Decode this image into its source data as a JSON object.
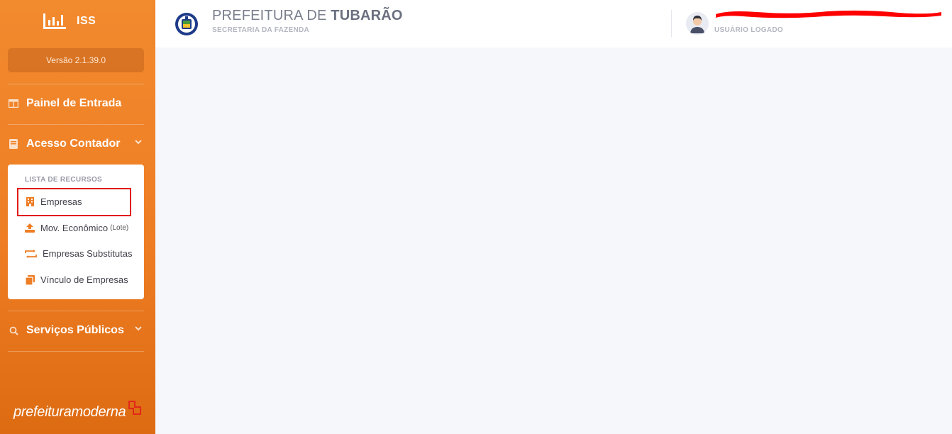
{
  "sidebar": {
    "brand": "ISS",
    "version": "Versão 2.1.39.0",
    "menu": [
      {
        "label": "Painel de Entrada",
        "icon": "dashboard-icon"
      },
      {
        "label": "Acesso Contador",
        "icon": "book-icon",
        "expanded": true
      },
      {
        "label": "Serviços Públicos",
        "icon": "search-icon",
        "expanded": false
      }
    ],
    "submenu": {
      "title": "LISTA DE RECURSOS",
      "items": [
        {
          "label": "Empresas",
          "icon": "building-icon",
          "highlighted": true
        },
        {
          "label": "Mov. Econômico",
          "suffix": "(Lote)",
          "icon": "upload-icon"
        },
        {
          "label": "Empresas Substitutas",
          "icon": "swap-icon"
        },
        {
          "label": "Vínculo de Empresas",
          "icon": "copy-icon"
        }
      ]
    },
    "footer": {
      "part1": "prefeitura",
      "part2": "moderna"
    }
  },
  "header": {
    "title_prefix": "PREFEITURA DE ",
    "title_bold": "TUBARÃO",
    "subtitle": "SECRETARIA DA FAZENDA",
    "user_label": "USUÁRIO LOGADO"
  },
  "colors": {
    "accent": "#ee7d24",
    "highlight": "#e01b1b",
    "redaction": "#ff0000"
  }
}
